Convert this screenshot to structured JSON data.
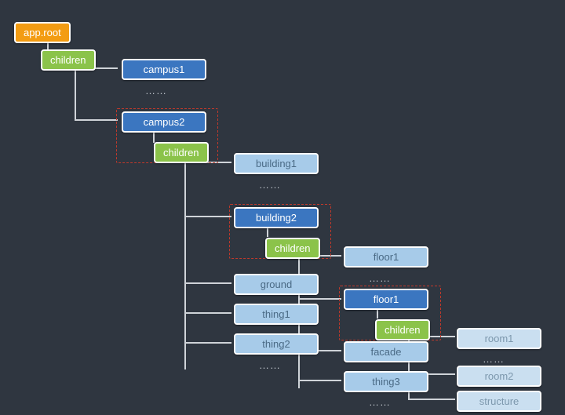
{
  "root": {
    "label": "app.root"
  },
  "children_label": "children",
  "ellipsis": "……",
  "level1": {
    "campus1": "campus1",
    "campus2": "campus2"
  },
  "level2": {
    "building1": "building1",
    "building2": "building2",
    "ground": "ground",
    "thing1": "thing1",
    "thing2": "thing2"
  },
  "level3": {
    "floor1a": "floor1",
    "floor1b": "floor1",
    "facade": "facade",
    "thing3": "thing3"
  },
  "level4": {
    "room1": "room1",
    "room2": "room2",
    "structure": "structure"
  }
}
